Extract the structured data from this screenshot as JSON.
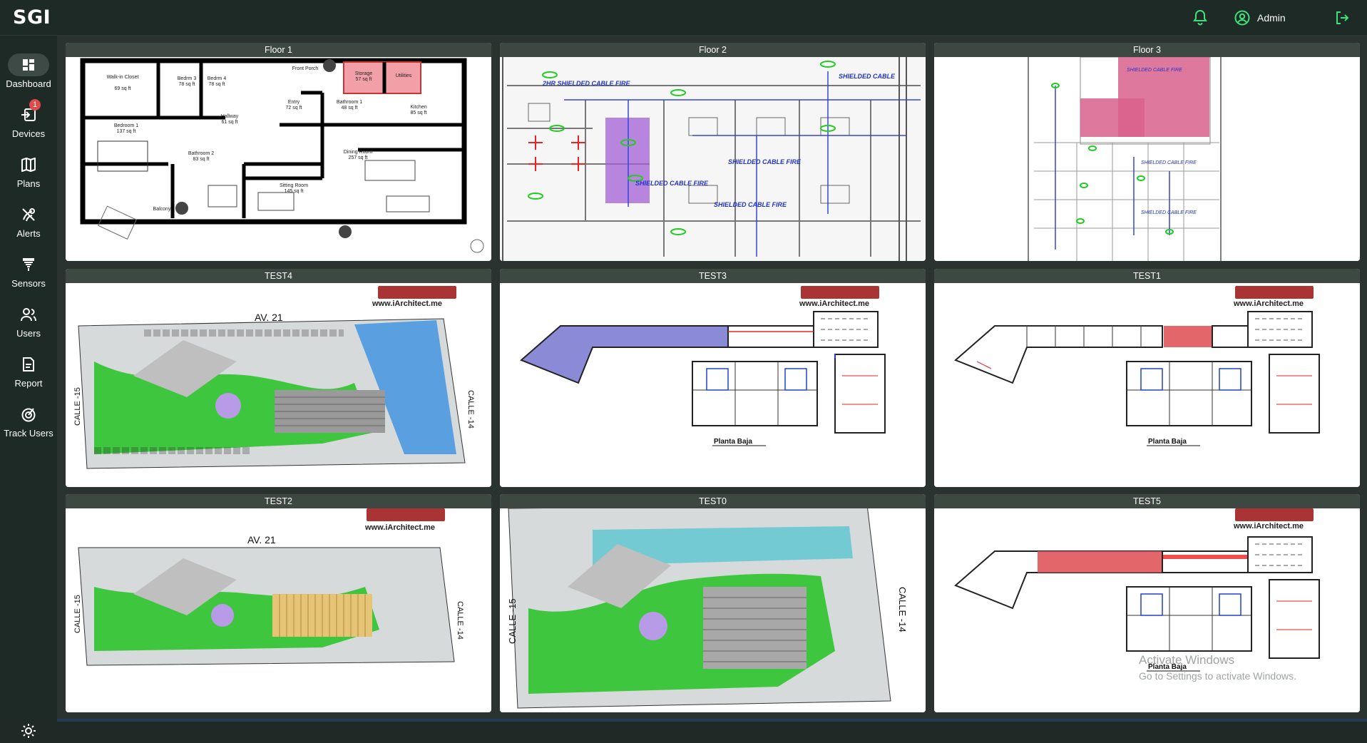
{
  "app": {
    "title": "SGI"
  },
  "header": {
    "user_name": "Admin"
  },
  "sidebar": {
    "items": [
      {
        "label": "Dashboard",
        "icon": "dashboard-icon",
        "active": true
      },
      {
        "label": "Devices",
        "icon": "devices-icon",
        "badge": "1"
      },
      {
        "label": "Plans",
        "icon": "map-icon"
      },
      {
        "label": "Alerts",
        "icon": "alert-icon"
      },
      {
        "label": "Sensors",
        "icon": "sensor-icon"
      },
      {
        "label": "Users",
        "icon": "users-icon"
      },
      {
        "label": "Report",
        "icon": "report-icon"
      },
      {
        "label": "Track Users",
        "icon": "track-icon"
      }
    ]
  },
  "cards": [
    {
      "title": "Floor 1"
    },
    {
      "title": "Floor 2"
    },
    {
      "title": "Floor 3"
    },
    {
      "title": "TEST4"
    },
    {
      "title": "TEST3"
    },
    {
      "title": "TEST1"
    },
    {
      "title": "TEST2"
    },
    {
      "title": "TEST0"
    },
    {
      "title": "TEST5"
    }
  ],
  "plan_text": {
    "floor1": {
      "rooms": [
        "Walk-in Closet",
        "Bedrm 3",
        "Bedrm 4",
        "Front Porch",
        "Storage",
        "Utilities",
        "Bedroom 1",
        "Hallway",
        "Entry",
        "Bathroom 1",
        "Kitchen",
        "Bathroom 2",
        "Dining Room",
        "Sitting Room",
        "Balcony"
      ],
      "areas": [
        "69 sq ft",
        "78 sq ft",
        "78 sq ft",
        "57 sq ft",
        "137 sq ft",
        "61 sq ft",
        "72 sq ft",
        "48 sq ft",
        "85 sq ft",
        "83 sq ft",
        "257 sq ft",
        "145 sq ft"
      ]
    },
    "site": {
      "brand": "www.iArchitect.me",
      "street_top": "AV. 21",
      "street_left": "CALLE -15",
      "street_right": "CALLE -14",
      "plan_label": "Planta Baja"
    }
  },
  "windows_watermark": {
    "line1": "Activate Windows",
    "line2": "Go to Settings to activate Windows."
  },
  "colors": {
    "background": "#1d2a26",
    "card_header": "#3e4843",
    "accent_red": "#e05a6a",
    "badge": "#e14a4a",
    "purple_zone": "#8f5bc7",
    "pink_zone": "#d9608c",
    "blue_zone": "#5c96d9",
    "lavender_zone": "#7b7fcf",
    "teal_zone": "#4bb5c0",
    "tan_zone": "#e0c070"
  }
}
